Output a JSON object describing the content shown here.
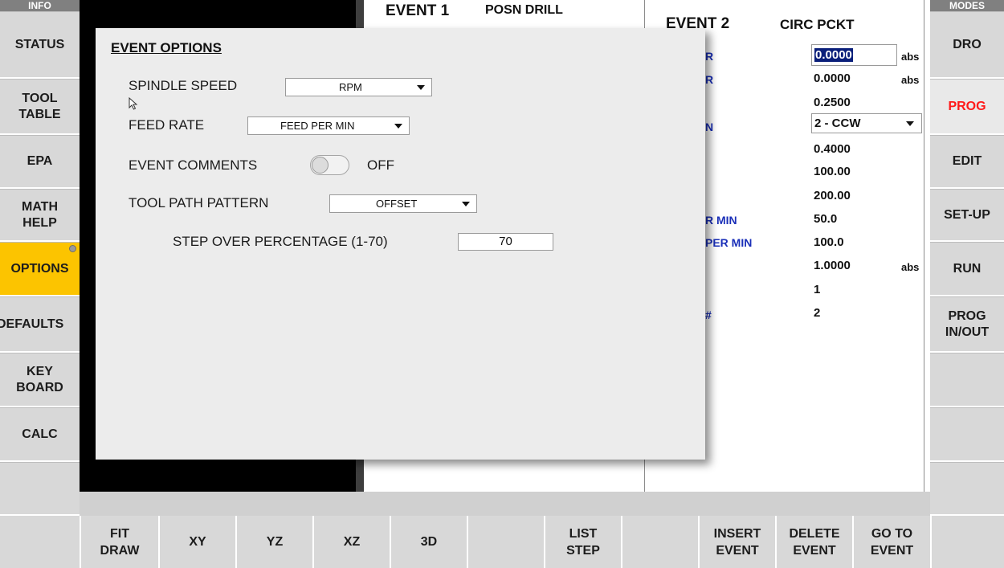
{
  "left_sidebar": {
    "header": "INFO",
    "items": [
      {
        "label": "STATUS"
      },
      {
        "label": "TOOL\nTABLE"
      },
      {
        "label": "EPA"
      },
      {
        "label": "MATH\nHELP"
      },
      {
        "label": "OPTIONS"
      },
      {
        "label": "DEFAULTS"
      },
      {
        "label": "KEY\nBOARD"
      },
      {
        "label": "CALC"
      },
      {
        "label": ""
      }
    ]
  },
  "right_sidebar": {
    "header": "MODES",
    "items": [
      {
        "label": "DRO"
      },
      {
        "label": "PROG"
      },
      {
        "label": "EDIT"
      },
      {
        "label": "SET-UP"
      },
      {
        "label": "RUN"
      },
      {
        "label": "PROG\nIN/OUT"
      },
      {
        "label": ""
      },
      {
        "label": ""
      },
      {
        "label": ""
      }
    ]
  },
  "bottom_bar": {
    "buttons": [
      {
        "label": "FIT\nDRAW"
      },
      {
        "label": "XY"
      },
      {
        "label": "YZ"
      },
      {
        "label": "XZ"
      },
      {
        "label": "3D"
      },
      {
        "label": ""
      },
      {
        "label": "LIST\nSTEP"
      },
      {
        "label": ""
      },
      {
        "label": "INSERT\nEVENT"
      },
      {
        "label": "DELETE\nEVENT"
      },
      {
        "label": "GO TO\nEVENT"
      }
    ]
  },
  "event1": {
    "title": "EVENT 1",
    "type": "POSN DRILL"
  },
  "event2": {
    "title": "EVENT 2",
    "type": "CIRC PCKT",
    "field_values": [
      "0.0000",
      "0.0000",
      "0.2500",
      "2 - CCW",
      "0.4000",
      "100.00",
      "200.00",
      "50.0",
      "100.0",
      "1.0000",
      "1",
      "2"
    ],
    "abs_label": "abs",
    "partial_labels": [
      "R",
      "R",
      "N",
      "R MIN",
      "PER MIN",
      "#"
    ]
  },
  "dialog": {
    "title": "EVENT OPTIONS",
    "spindle_speed": {
      "label": "SPINDLE SPEED",
      "value": "RPM"
    },
    "feed_rate": {
      "label": "FEED RATE",
      "value": "FEED PER MIN"
    },
    "event_comments": {
      "label": "EVENT COMMENTS",
      "state": "OFF"
    },
    "tool_path_pattern": {
      "label": "TOOL PATH PATTERN",
      "value": "OFFSET"
    },
    "step_over": {
      "label": "STEP OVER PERCENTAGE (1-70)",
      "value": "70"
    }
  },
  "colors": {
    "active_options": "#fcc400",
    "active_prog_text": "#ff1a1a",
    "field_label_blue": "#1a2fb8",
    "selected_field": "#0a1f7a"
  }
}
